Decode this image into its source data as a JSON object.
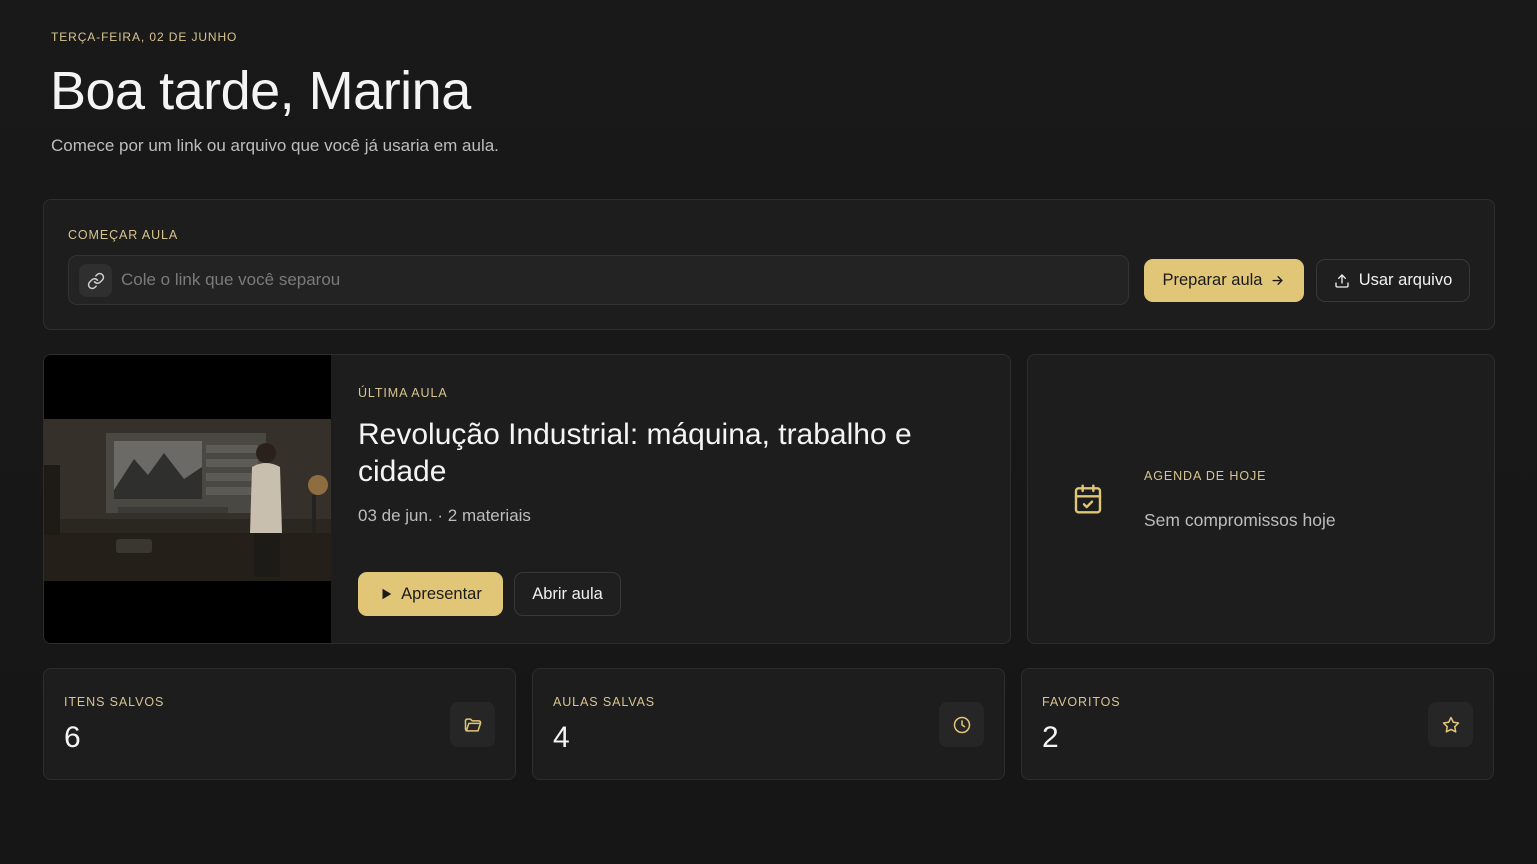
{
  "header": {
    "date": "TERÇA-FEIRA, 02 DE JUNHO",
    "greeting": "Boa tarde, Marina",
    "subtitle": "Comece por um link ou arquivo que você já usaria em aula."
  },
  "start_lesson": {
    "label": "COMEÇAR AULA",
    "link_placeholder": "Cole o link que você separou",
    "link_value": "",
    "prepare_button": "Preparar aula",
    "file_button": "Usar arquivo"
  },
  "last_lesson": {
    "label": "ÚLTIMA AULA",
    "title": "Revolução Industrial: máquina, trabalho e cidade",
    "meta": "03 de jun. · 2 materiais",
    "present_button": "Apresentar",
    "open_button": "Abrir aula",
    "thumbnail": "classroom-presentation-thumbnail"
  },
  "agenda": {
    "label": "AGENDA DE HOJE",
    "text": "Sem compromissos hoje",
    "icon": "calendar-check-icon"
  },
  "stats": [
    {
      "label": "ITENS SALVOS",
      "value": "6",
      "icon": "folder-icon"
    },
    {
      "label": "AULAS SALVAS",
      "value": "4",
      "icon": "clock-icon"
    },
    {
      "label": "FAVORITOS",
      "value": "2",
      "icon": "star-icon"
    }
  ],
  "colors": {
    "background": "#171717",
    "card": "#1d1d1d",
    "accent": "#e2c678",
    "eyebrow": "#d8c490"
  }
}
